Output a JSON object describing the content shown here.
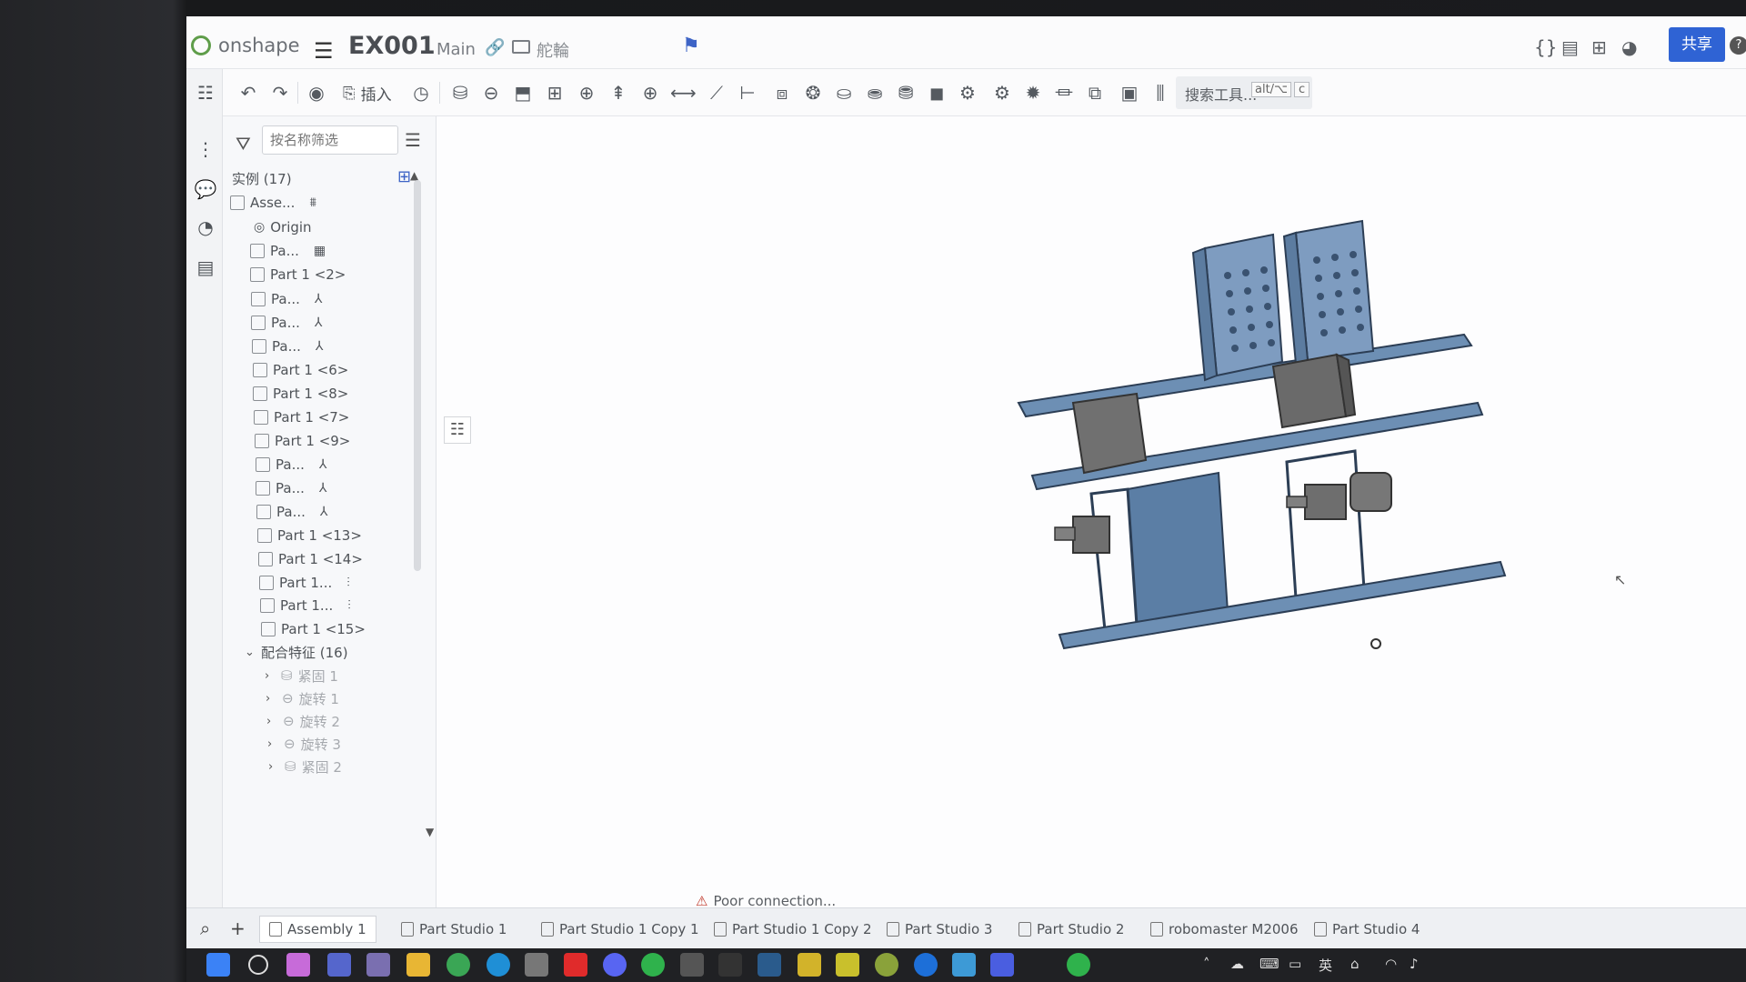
{
  "header": {
    "logo_text": "onshape",
    "doc_title": "EX001",
    "branch": "Main",
    "folder": "舵輪",
    "share_label": "共享",
    "help_label": "?"
  },
  "toolbar": {
    "insert_label": "插入",
    "search_tools_label": "搜索工具...",
    "shortcut_key1": "alt/⌥",
    "shortcut_key2": "c"
  },
  "tree": {
    "filter_placeholder": "按名称筛选",
    "instances_header": "实例 (17)",
    "items": [
      {
        "label": "Asse...",
        "icon": "stack-icon"
      },
      {
        "label": "Origin",
        "icon": "origin-icon"
      },
      {
        "label": "Pa...",
        "icon": "pattern-icon"
      },
      {
        "label": "Part 1 <2>"
      },
      {
        "label": "Pa...",
        "icon": "mate-connector-icon"
      },
      {
        "label": "Pa...",
        "icon": "mate-connector-icon"
      },
      {
        "label": "Pa...",
        "icon": "mate-connector-icon"
      },
      {
        "label": "Part 1 <6>"
      },
      {
        "label": "Part 1 <8>"
      },
      {
        "label": "Part 1 <7>"
      },
      {
        "label": "Part 1 <9>"
      },
      {
        "label": "Pa...",
        "icon": "mate-connector-icon"
      },
      {
        "label": "Pa...",
        "icon": "mate-connector-icon"
      },
      {
        "label": "Pa...",
        "icon": "mate-connector-icon"
      },
      {
        "label": "Part 1 <13>"
      },
      {
        "label": "Part 1 <14>"
      },
      {
        "label": "Part 1...",
        "icon": "dot-line-icon"
      },
      {
        "label": "Part 1...",
        "icon": "dot-line-icon"
      },
      {
        "label": "Part 1 <15>"
      }
    ],
    "mates_header": "配合特征 (16)",
    "mates": [
      "紧固 1",
      "旋转 1",
      "旋转 2",
      "旋转 3",
      "紧固 2"
    ]
  },
  "viewport": {
    "status": "Poor connection..."
  },
  "tabs": [
    {
      "label": "Assembly 1",
      "active": true
    },
    {
      "label": "Part Studio 1"
    },
    {
      "label": "Part Studio 1 Copy 1"
    },
    {
      "label": "Part Studio 1 Copy 2"
    },
    {
      "label": "Part Studio 3"
    },
    {
      "label": "Part Studio 2"
    },
    {
      "label": "robomaster M2006"
    },
    {
      "label": "Part Studio 4"
    }
  ],
  "taskbar": {
    "ime_label": "英"
  },
  "colors": {
    "accent": "#2f63d4",
    "model_plate": "#6d8fb4",
    "model_block": "#707070",
    "logo_green": "#5f9d4a"
  }
}
